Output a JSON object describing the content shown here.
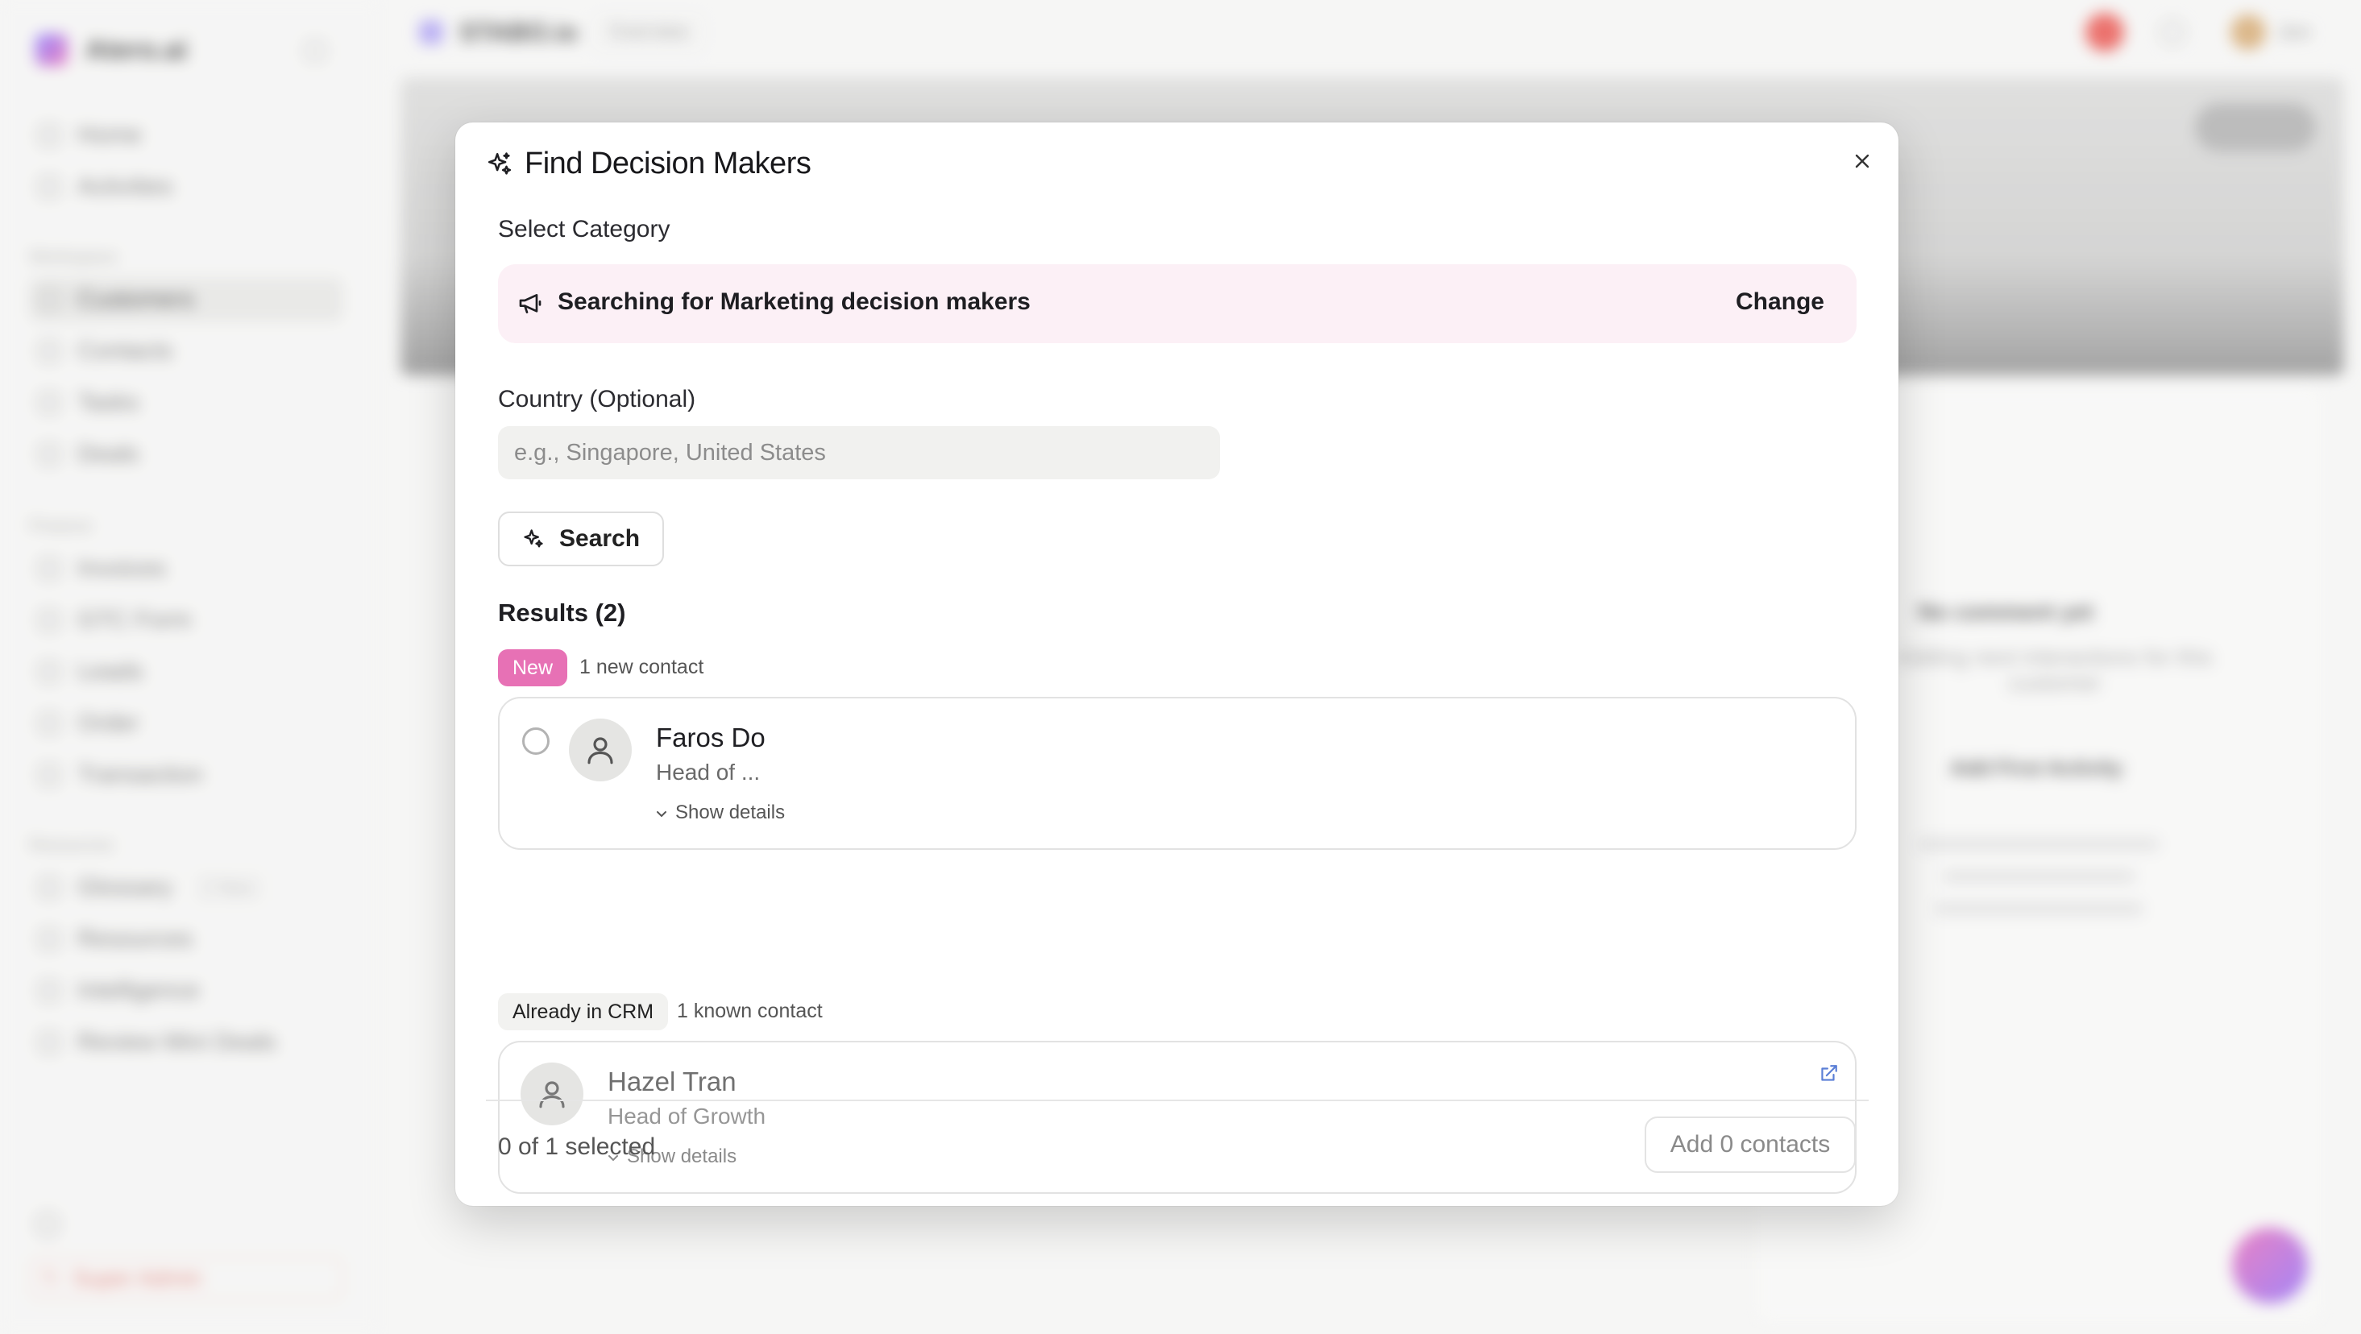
{
  "background": {
    "brand": "Atero.ai",
    "sidebar": {
      "items": [
        {
          "label": "Home"
        },
        {
          "label": "Activities"
        }
      ],
      "group_workspace": "Workspace",
      "workspace_items": [
        {
          "label": "Customers",
          "active": true
        },
        {
          "label": "Contacts"
        },
        {
          "label": "Tasks"
        },
        {
          "label": "Deals"
        }
      ],
      "group_finance": "Finance",
      "finance_items": [
        {
          "label": "Invoices"
        },
        {
          "label": "GTC Form"
        },
        {
          "label": "Leads"
        },
        {
          "label": "Order"
        },
        {
          "label": "Transaction"
        }
      ],
      "group_resources": "Resources",
      "resource_items": [
        {
          "label": "Glossary",
          "badge": "2 New"
        },
        {
          "label": "Resources"
        },
        {
          "label": "Intelligence"
        },
        {
          "label": "Review Mini Deals"
        }
      ],
      "logout": "Super Admin"
    },
    "topbar": {
      "title": "STABO.io",
      "tag": "Overview"
    },
    "panel": {
      "title": "No comment yet",
      "subtitle": "Adding next interactions for this customer",
      "action": "Add First Activity"
    }
  },
  "modal": {
    "title": "Find Decision Makers",
    "close_icon": "close-icon",
    "select_category_label": "Select Category",
    "category_text": "Searching for Marketing decision makers",
    "change_label": "Change",
    "country_label": "Country (Optional)",
    "country_placeholder": "e.g., Singapore, United States",
    "country_value": "",
    "search_label": "Search",
    "results_label": "Results (2)",
    "new_group": {
      "badge": "New",
      "count_text": "1 new contact",
      "badge_color": "#e771b5",
      "contacts": [
        {
          "name": "Faros Do",
          "role": "Head of ...",
          "details_label": "Show details",
          "selected": false
        }
      ]
    },
    "crm_group": {
      "badge": "Already in CRM",
      "count_text": "1 known contact",
      "contacts": [
        {
          "name": "Hazel Tran",
          "role": "Head of Growth",
          "details_label": "Show details"
        }
      ]
    },
    "footer": {
      "selected_text": "0 of 1 selected",
      "add_label": "Add 0 contacts"
    }
  }
}
